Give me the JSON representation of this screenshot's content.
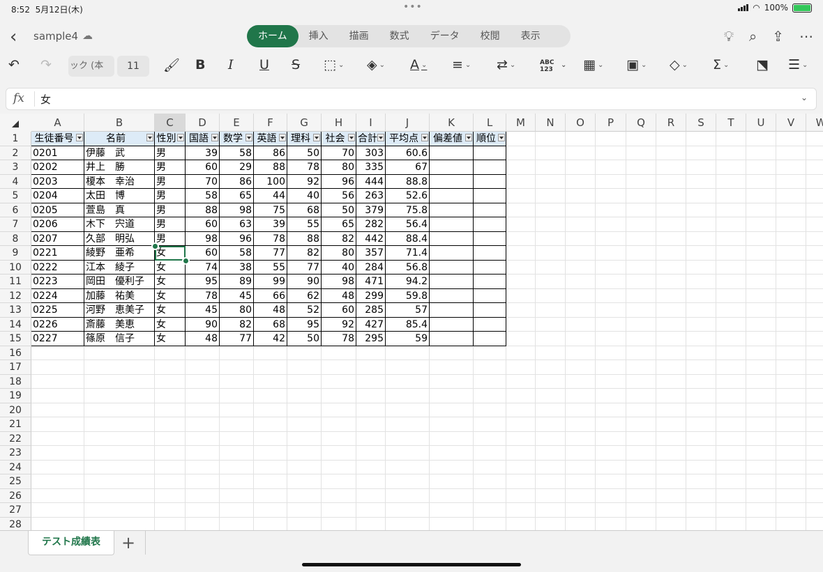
{
  "status": {
    "time": "8:52",
    "date": "5月12日(木)",
    "battery": "100%"
  },
  "title": {
    "doc_name": "sample4"
  },
  "tabs": [
    "ホーム",
    "挿入",
    "描画",
    "数式",
    "データ",
    "校閲",
    "表示"
  ],
  "ribbon": {
    "font_name": "ック (本",
    "font_size": "11",
    "abc_top": "ABC",
    "abc_bottom": "123"
  },
  "formula": {
    "label": "fx",
    "value": "女"
  },
  "columns": [
    "A",
    "B",
    "C",
    "D",
    "E",
    "F",
    "G",
    "H",
    "I",
    "J",
    "K",
    "L",
    "M",
    "N",
    "O",
    "P",
    "Q",
    "R",
    "S",
    "T",
    "U",
    "V",
    "W"
  ],
  "selected_column": "C",
  "row_count": 28,
  "table": {
    "headers": [
      "生徒番号",
      "名前",
      "性別",
      "国語",
      "数学",
      "英語",
      "理科",
      "社会",
      "合計",
      "平均点",
      "偏差値",
      "順位"
    ],
    "rows": [
      [
        "0201",
        "伊藤　武",
        "男",
        "39",
        "58",
        "86",
        "50",
        "70",
        "303",
        "60.6",
        "",
        ""
      ],
      [
        "0202",
        "井上　勝",
        "男",
        "60",
        "29",
        "88",
        "78",
        "80",
        "335",
        "67",
        "",
        ""
      ],
      [
        "0203",
        "榎本　幸治",
        "男",
        "70",
        "86",
        "100",
        "92",
        "96",
        "444",
        "88.8",
        "",
        ""
      ],
      [
        "0204",
        "太田　博",
        "男",
        "58",
        "65",
        "44",
        "40",
        "56",
        "263",
        "52.6",
        "",
        ""
      ],
      [
        "0205",
        "萱島　真",
        "男",
        "88",
        "98",
        "75",
        "68",
        "50",
        "379",
        "75.8",
        "",
        ""
      ],
      [
        "0206",
        "木下　宍道",
        "男",
        "60",
        "63",
        "39",
        "55",
        "65",
        "282",
        "56.4",
        "",
        ""
      ],
      [
        "0207",
        "久部　明弘",
        "男",
        "98",
        "96",
        "78",
        "88",
        "82",
        "442",
        "88.4",
        "",
        ""
      ],
      [
        "0221",
        "綾野　亜希",
        "女",
        "60",
        "58",
        "77",
        "82",
        "80",
        "357",
        "71.4",
        "",
        ""
      ],
      [
        "0222",
        "江本　綾子",
        "女",
        "74",
        "38",
        "55",
        "77",
        "40",
        "284",
        "56.8",
        "",
        ""
      ],
      [
        "0223",
        "岡田　優利子",
        "女",
        "95",
        "89",
        "99",
        "90",
        "98",
        "471",
        "94.2",
        "",
        ""
      ],
      [
        "0224",
        "加藤　祐美",
        "女",
        "78",
        "45",
        "66",
        "62",
        "48",
        "299",
        "59.8",
        "",
        ""
      ],
      [
        "0225",
        "河野　恵美子",
        "女",
        "45",
        "80",
        "48",
        "52",
        "60",
        "285",
        "57",
        "",
        ""
      ],
      [
        "0226",
        "斎藤　美恵",
        "女",
        "90",
        "82",
        "68",
        "95",
        "92",
        "427",
        "85.4",
        "",
        ""
      ],
      [
        "0227",
        "篠原　信子",
        "女",
        "48",
        "77",
        "42",
        "50",
        "78",
        "295",
        "59",
        "",
        ""
      ]
    ]
  },
  "sheet": {
    "tab_name": "テスト成績表",
    "add_label": "+"
  },
  "colors": {
    "accent": "#20764a",
    "header_fill": "#ddebf7"
  }
}
